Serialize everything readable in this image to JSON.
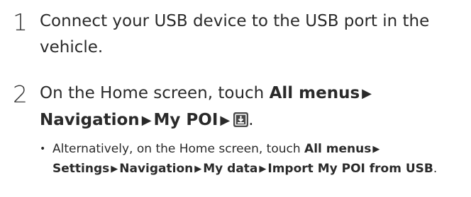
{
  "step1": {
    "number": "1",
    "text": "Connect your USB device to the USB port in the vehicle."
  },
  "step2": {
    "number": "2",
    "prefix": "On the Home screen, touch ",
    "path": [
      "All menus",
      "Navigation",
      "My POI"
    ],
    "separator": "▶",
    "end_icon": "import-usb-icon",
    "suffix": "."
  },
  "note": {
    "bullet": "•",
    "prefix": "Alternatively, on the Home screen, touch ",
    "path": [
      "All menus",
      "Settings",
      "Navigation",
      "My data",
      "Import My POI from USB"
    ],
    "separator": "▶",
    "suffix": "."
  }
}
